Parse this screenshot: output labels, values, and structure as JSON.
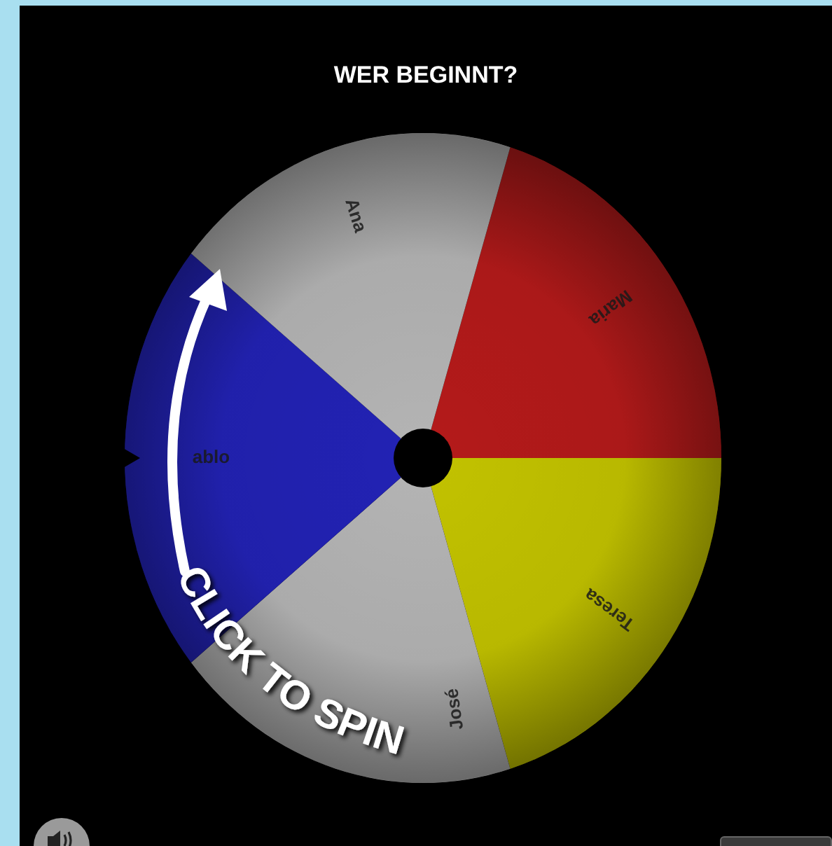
{
  "title": "WER BEGINNT?",
  "segments": [
    {
      "label": "Maria",
      "color": "#b41a1a"
    },
    {
      "label": "Teresa",
      "color": "#c2c200"
    },
    {
      "label": "José",
      "color": "#b4b4b4"
    },
    {
      "label": "ablo",
      "color": "#2222b4"
    },
    {
      "label": "Ana",
      "color": "#b4b4b4"
    }
  ],
  "spin_label": "CLICK TO SPIN"
}
